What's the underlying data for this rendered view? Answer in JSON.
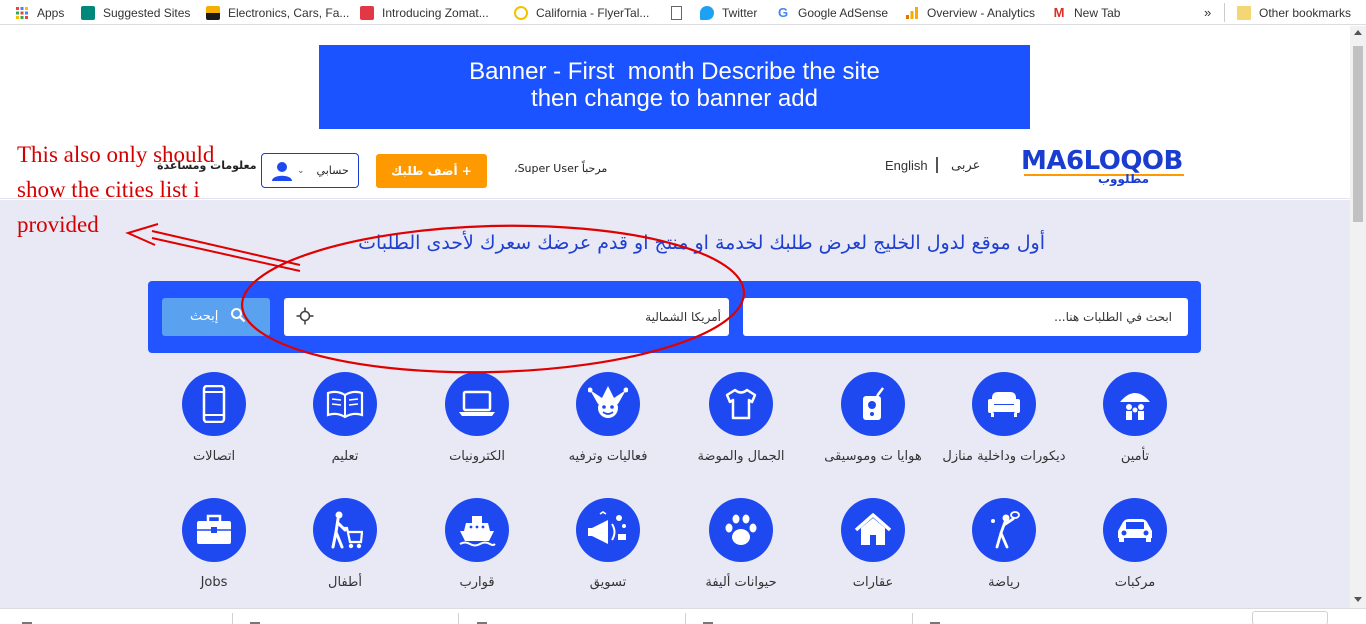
{
  "bookmarks": [
    {
      "label": "Apps",
      "icon": "apps-grid-icon",
      "color": "#e8453c"
    },
    {
      "label": "Suggested Sites",
      "icon": "bing-icon",
      "color": "#00897b"
    },
    {
      "label": "Electronics, Cars, Fa...",
      "icon": "shopping-bag-icon",
      "color": "#f5af02"
    },
    {
      "label": "Introducing Zomat...",
      "icon": "zomato-icon",
      "color": "#e23744"
    },
    {
      "label": "California - FlyerTal...",
      "icon": "speech-bubble-icon",
      "color": "#f2c200"
    },
    {
      "label": "",
      "icon": "blank-page-icon",
      "color": "#888888"
    },
    {
      "label": "Twitter",
      "icon": "twitter-bird-icon",
      "color": "#1da1f2"
    },
    {
      "label": "Google AdSense",
      "icon": "google-g-icon",
      "color": "#4285f4"
    },
    {
      "label": "Overview - Analytics",
      "icon": "analytics-bars-icon",
      "color": "#f9ab00"
    },
    {
      "label": "New Tab",
      "icon": "gmail-m-icon",
      "color": "#d93025"
    }
  ],
  "bookmarks_overflow": "»",
  "other_bookmarks": "Other bookmarks",
  "banner": {
    "line1": "Banner - First  month Describe the site",
    "line2": "then change to banner add"
  },
  "annotation_note": "This also only should show the cities list i provided",
  "header": {
    "help": "معلومات ومساعدة",
    "account": "حسابي",
    "add_request": "+ أضف طلبك",
    "welcome": "مرحباً Super User،",
    "english": "English",
    "arabic": "عربى",
    "logo": "MA6LOQOB",
    "logo_sub": "مطلووب"
  },
  "tagline": "أول موقع لدول الخليج لعرض طلبك لخدمة او منتج او قدم عرضك سعرك لأحدى الطلبات",
  "search": {
    "placeholder": "ابحث في الطلبات هنا...",
    "city_value": "أمريكا الشمالية",
    "button": "إبحث"
  },
  "categories_row1": [
    {
      "label": "تأمين",
      "icon": "umbrella-family-icon"
    },
    {
      "label": "ديكورات وداخلية منازل",
      "icon": "sofa-icon"
    },
    {
      "label": "هوايا ت وموسيقى",
      "icon": "remote-control-icon"
    },
    {
      "label": "الجمال والموضة",
      "icon": "tshirt-icon"
    },
    {
      "label": "فعاليات وترفيه",
      "icon": "jester-hat-icon"
    },
    {
      "label": "الكترونيات",
      "icon": "laptop-icon"
    },
    {
      "label": "تعليم",
      "icon": "open-book-icon"
    },
    {
      "label": "اتصالات",
      "icon": "smartphone-icon"
    }
  ],
  "categories_row2": [
    {
      "label": "مركبات",
      "icon": "car-icon"
    },
    {
      "label": "رياضة",
      "icon": "tennis-player-icon"
    },
    {
      "label": "عقارات",
      "icon": "house-icon"
    },
    {
      "label": "حيوانات أليفة",
      "icon": "paw-icon"
    },
    {
      "label": "تسويق",
      "icon": "megaphone-icon"
    },
    {
      "label": "قوارب",
      "icon": "boat-icon"
    },
    {
      "label": "أطفال",
      "icon": "stroller-icon"
    },
    {
      "label": "Jobs",
      "icon": "briefcase-icon"
    }
  ],
  "colors": {
    "brand_blue": "#1f49f0",
    "accent_orange": "#ff9900",
    "annotation_red": "#d40000"
  }
}
